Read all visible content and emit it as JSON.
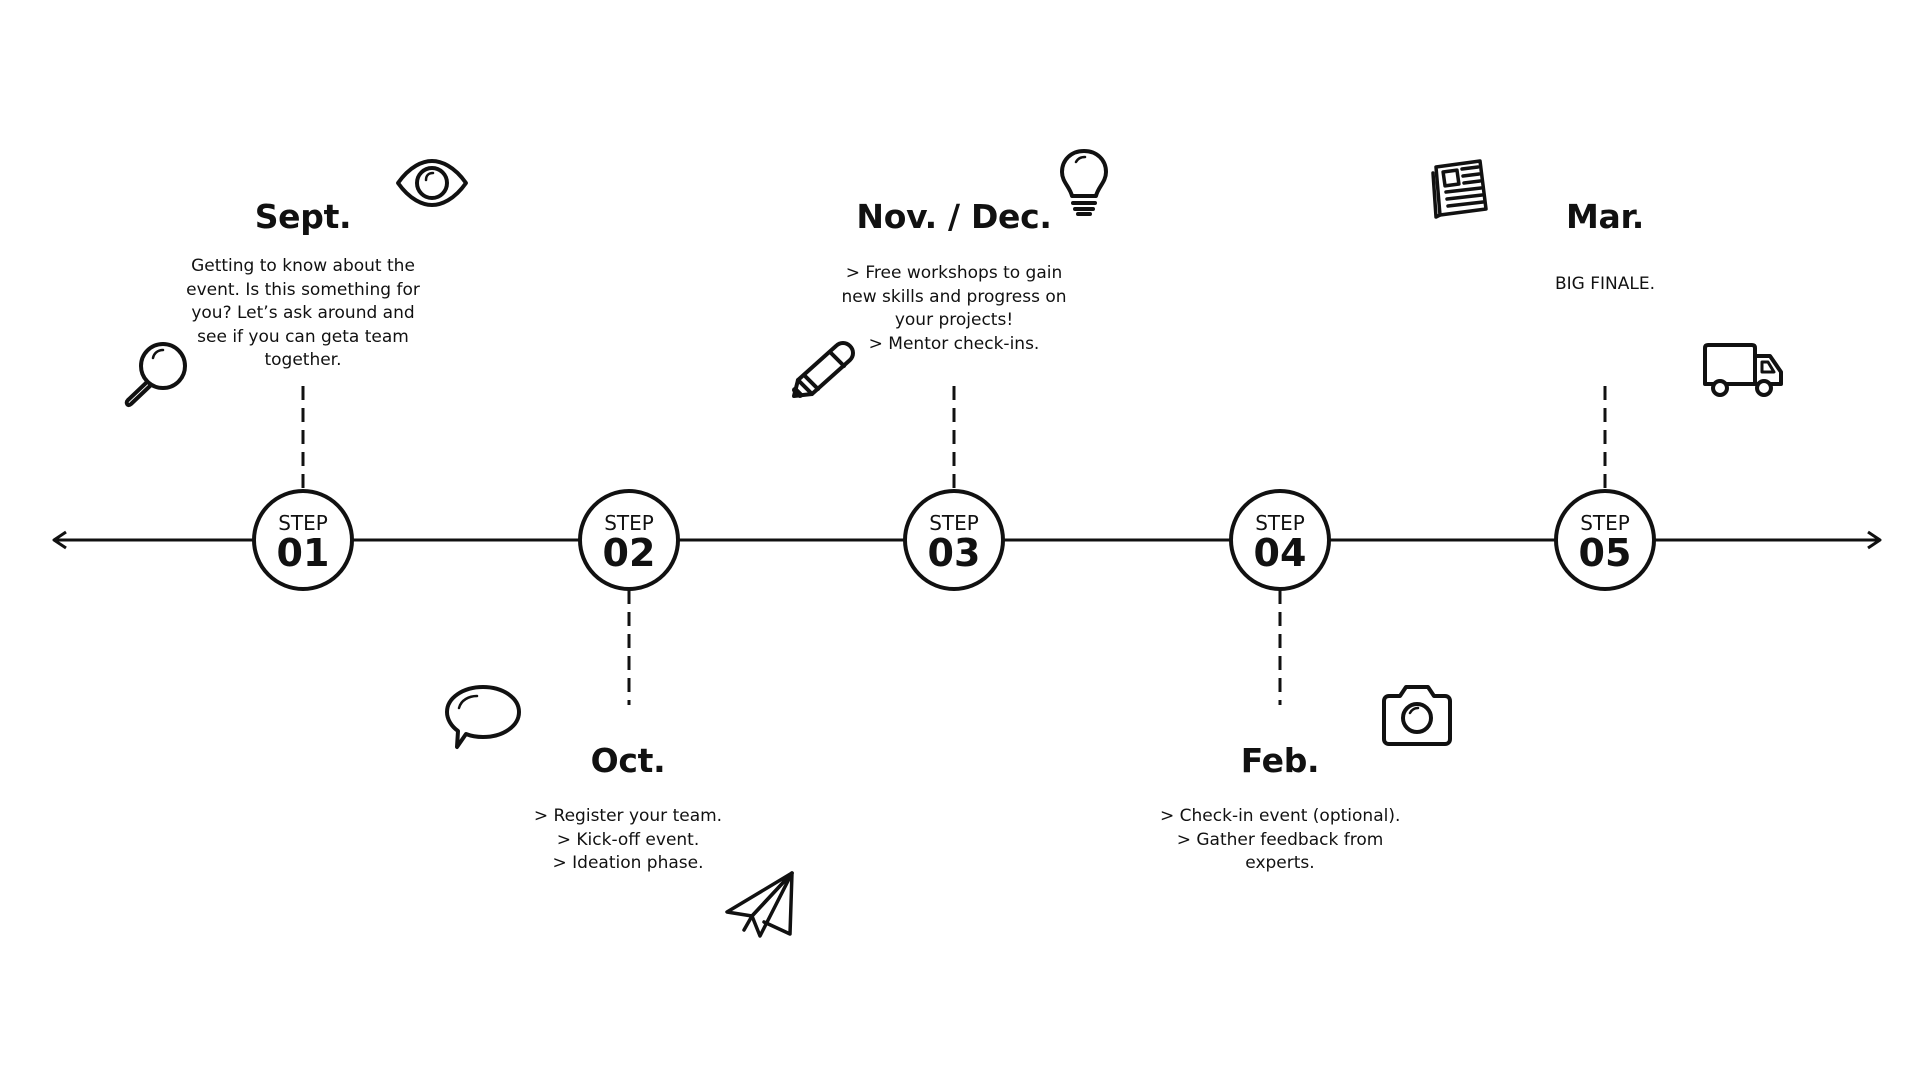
{
  "steps": [
    {
      "label": "STEP",
      "number": "01",
      "month": "Sept.",
      "lines": [
        "Getting to know about the",
        "event.  Is this something for",
        "you? Let’s ask around and",
        "see if you can  geta team",
        "together."
      ]
    },
    {
      "label": "STEP",
      "number": "02",
      "month": "Oct.",
      "lines": [
        "> Register your team.",
        "> Kick-off event.",
        "> Ideation phase."
      ]
    },
    {
      "label": "STEP",
      "number": "03",
      "month": "Nov. / Dec.",
      "lines": [
        "> Free workshops to gain",
        "new skills and progress on",
        "your projects!",
        "> Mentor check-ins."
      ]
    },
    {
      "label": "STEP",
      "number": "04",
      "month": "Feb.",
      "lines": [
        "> Check-in event (optional).",
        "> Gather feedback from",
        "experts."
      ]
    },
    {
      "label": "STEP",
      "number": "05",
      "month": "Mar.",
      "lines": [
        "BIG FINALE."
      ]
    }
  ],
  "icons": [
    "eye-icon",
    "magnifier-icon",
    "lightbulb-icon",
    "pencil-icon",
    "newspaper-icon",
    "truck-icon",
    "speech-bubble-icon",
    "paper-plane-icon",
    "camera-icon"
  ],
  "colors": {
    "ink": "#111111",
    "background": "#ffffff"
  }
}
